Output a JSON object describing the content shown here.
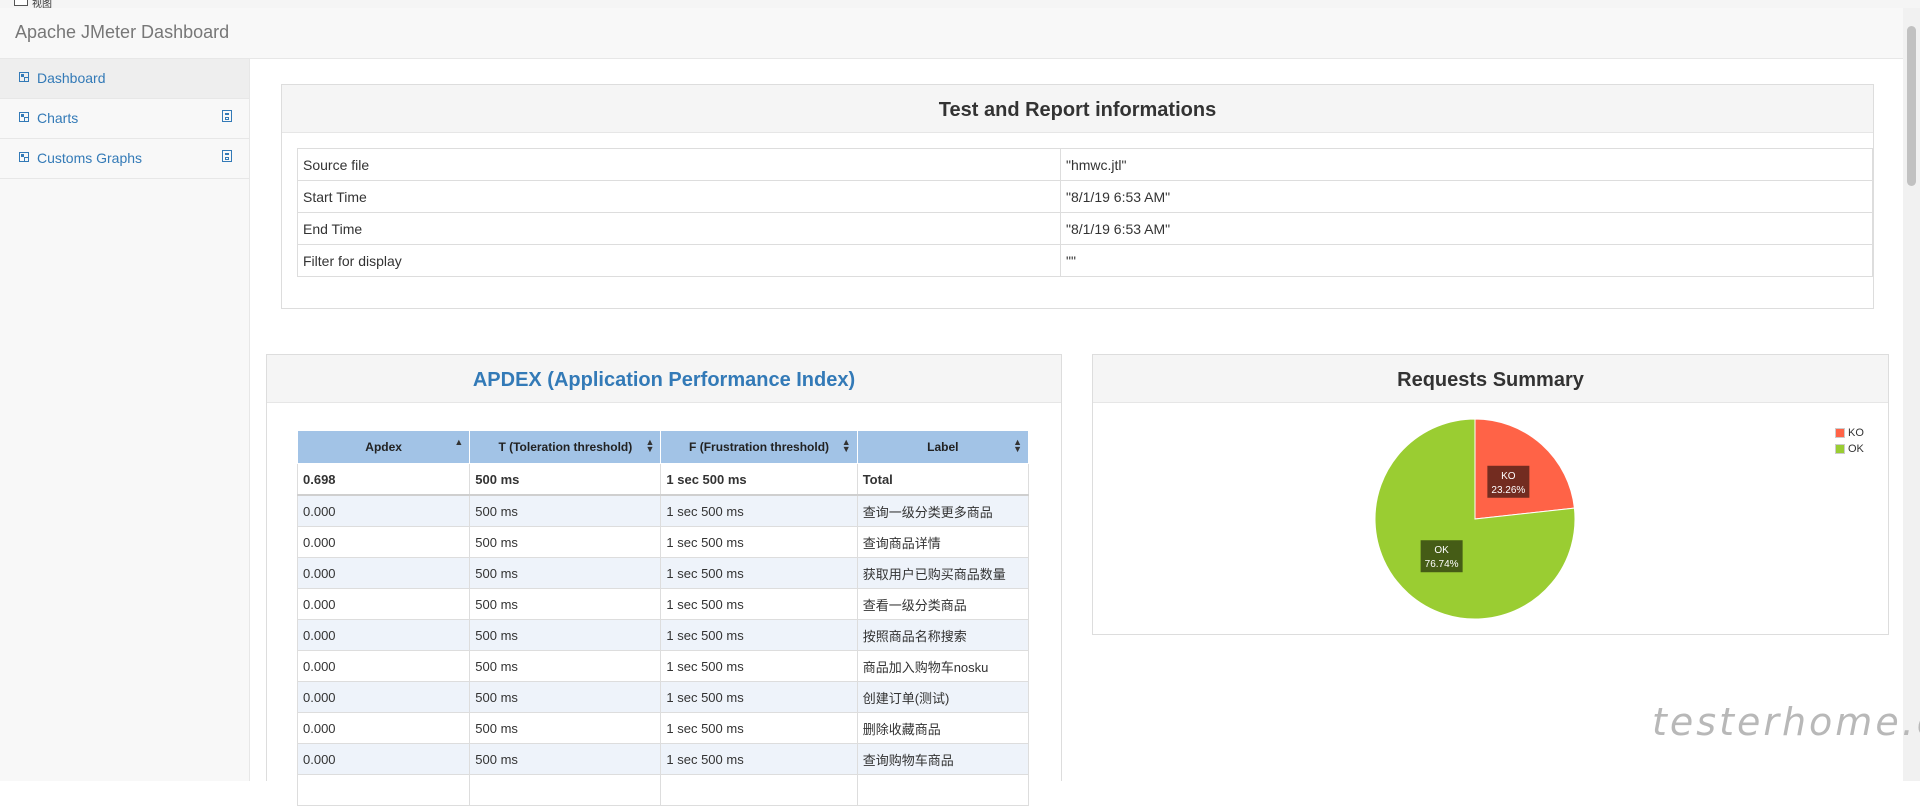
{
  "window": {
    "title_fragment": "视图"
  },
  "navbar": {
    "brand": "Apache JMeter Dashboard"
  },
  "sidebar": {
    "items": [
      {
        "label": "Dashboard",
        "icon": "dashboard-icon",
        "active": true
      },
      {
        "label": "Charts",
        "icon": "chart-icon",
        "expand_icon": "expand-icon"
      },
      {
        "label": "Customs Graphs",
        "icon": "chart-icon",
        "expand_icon": "expand-icon"
      }
    ]
  },
  "test_info": {
    "title": "Test and Report informations",
    "rows": [
      {
        "key": "Source file",
        "value": "\"hmwc.jtl\""
      },
      {
        "key": "Start Time",
        "value": "\"8/1/19 6:53 AM\""
      },
      {
        "key": "End Time",
        "value": "\"8/1/19 6:53 AM\""
      },
      {
        "key": "Filter for display",
        "value": "\"\""
      }
    ]
  },
  "apdex": {
    "title": "APDEX (Application Performance Index)",
    "columns": [
      "Apdex",
      "T (Toleration threshold)",
      "F (Frustration threshold)",
      "Label"
    ],
    "sort_icons": [
      "▲",
      "▲▼",
      "▲▼",
      "▲▼"
    ],
    "total": {
      "apdex": "0.698",
      "t": "500 ms",
      "f": "1 sec 500 ms",
      "label": "Total"
    },
    "rows": [
      {
        "apdex": "0.000",
        "t": "500 ms",
        "f": "1 sec 500 ms",
        "label": "查询一级分类更多商品"
      },
      {
        "apdex": "0.000",
        "t": "500 ms",
        "f": "1 sec 500 ms",
        "label": "查询商品详情"
      },
      {
        "apdex": "0.000",
        "t": "500 ms",
        "f": "1 sec 500 ms",
        "label": "获取用户已购买商品数量"
      },
      {
        "apdex": "0.000",
        "t": "500 ms",
        "f": "1 sec 500 ms",
        "label": "查看一级分类商品"
      },
      {
        "apdex": "0.000",
        "t": "500 ms",
        "f": "1 sec 500 ms",
        "label": "按照商品名称搜索"
      },
      {
        "apdex": "0.000",
        "t": "500 ms",
        "f": "1 sec 500 ms",
        "label": "商品加入购物车nosku"
      },
      {
        "apdex": "0.000",
        "t": "500 ms",
        "f": "1 sec 500 ms",
        "label": "创建订单(测试)"
      },
      {
        "apdex": "0.000",
        "t": "500 ms",
        "f": "1 sec 500 ms",
        "label": "删除收藏商品"
      },
      {
        "apdex": "0.000",
        "t": "500 ms",
        "f": "1 sec 500 ms",
        "label": "查询购物车商品"
      }
    ]
  },
  "requests_summary": {
    "title": "Requests Summary",
    "legend": [
      {
        "label": "KO",
        "color": "#ff6347"
      },
      {
        "label": "OK",
        "color": "#9acd32"
      }
    ]
  },
  "chart_data": {
    "type": "pie",
    "title": "Requests Summary",
    "slices": [
      {
        "label": "KO",
        "value": 23.26,
        "value_label": "23.26%",
        "color": "#ff6347"
      },
      {
        "label": "OK",
        "value": 76.74,
        "value_label": "76.74%",
        "color": "#9acd32"
      }
    ],
    "legend_position": "top-right"
  },
  "watermark": "testerhome.com"
}
